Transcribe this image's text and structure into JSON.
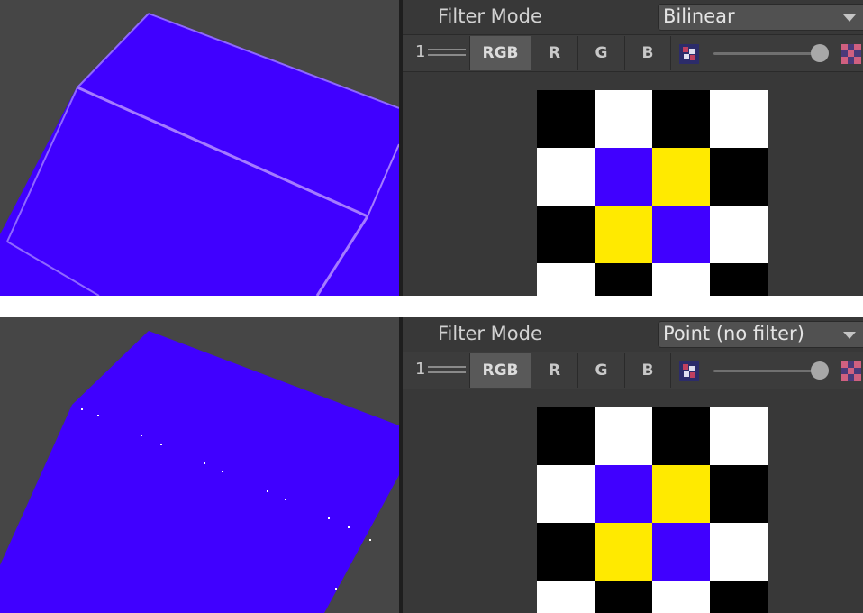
{
  "colors": {
    "viewport_bg": "#464646",
    "inspector_bg": "#383838",
    "cube_face": "#4000ff",
    "cube_edge_bilinear": "#9a6bff",
    "cube_seam_point": "#ffffff",
    "black": "#000000",
    "white": "#ffffff",
    "blue": "#4000ff",
    "yellow": "#ffea00"
  },
  "texture_grid": [
    [
      "black",
      "white",
      "black",
      "white"
    ],
    [
      "white",
      "blue",
      "yellow",
      "black"
    ],
    [
      "black",
      "yellow",
      "blue",
      "white"
    ],
    [
      "white",
      "black",
      "white",
      "black"
    ]
  ],
  "panels": [
    {
      "id": "top",
      "filter_label": "Filter Mode",
      "filter_value": "Bilinear",
      "mip_glyph": "1",
      "channels": [
        "RGB",
        "R",
        "G",
        "B"
      ],
      "active_channel": "RGB",
      "mip_slider_value": 1.0,
      "icons": [
        "texture-preview-icon",
        "alpha-checker-icon"
      ]
    },
    {
      "id": "bottom",
      "filter_label": "Filter Mode",
      "filter_value": "Point (no filter)",
      "mip_glyph": "1",
      "channels": [
        "RGB",
        "R",
        "G",
        "B"
      ],
      "active_channel": "RGB",
      "mip_slider_value": 1.0,
      "icons": [
        "texture-preview-icon",
        "alpha-checker-icon"
      ]
    }
  ]
}
